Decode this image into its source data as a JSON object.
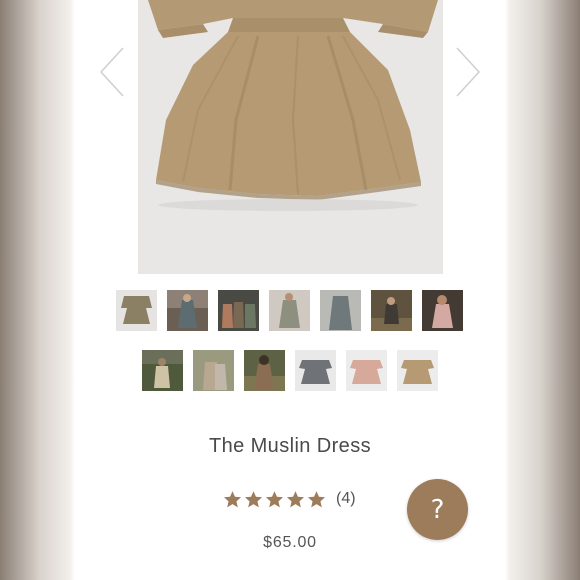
{
  "product": {
    "title": "The Muslin Dress",
    "rating_count": "(4)",
    "rating_stars": 5,
    "price": "$65.00"
  },
  "gallery": {
    "prev_icon": "chevron-left-icon",
    "next_icon": "chevron-right-icon",
    "thumbnail_count": 13
  },
  "help": {
    "label": "?"
  },
  "colors": {
    "accent": "#9c7c5b",
    "star": "#9c7c5b",
    "dress": "#b59a73"
  }
}
